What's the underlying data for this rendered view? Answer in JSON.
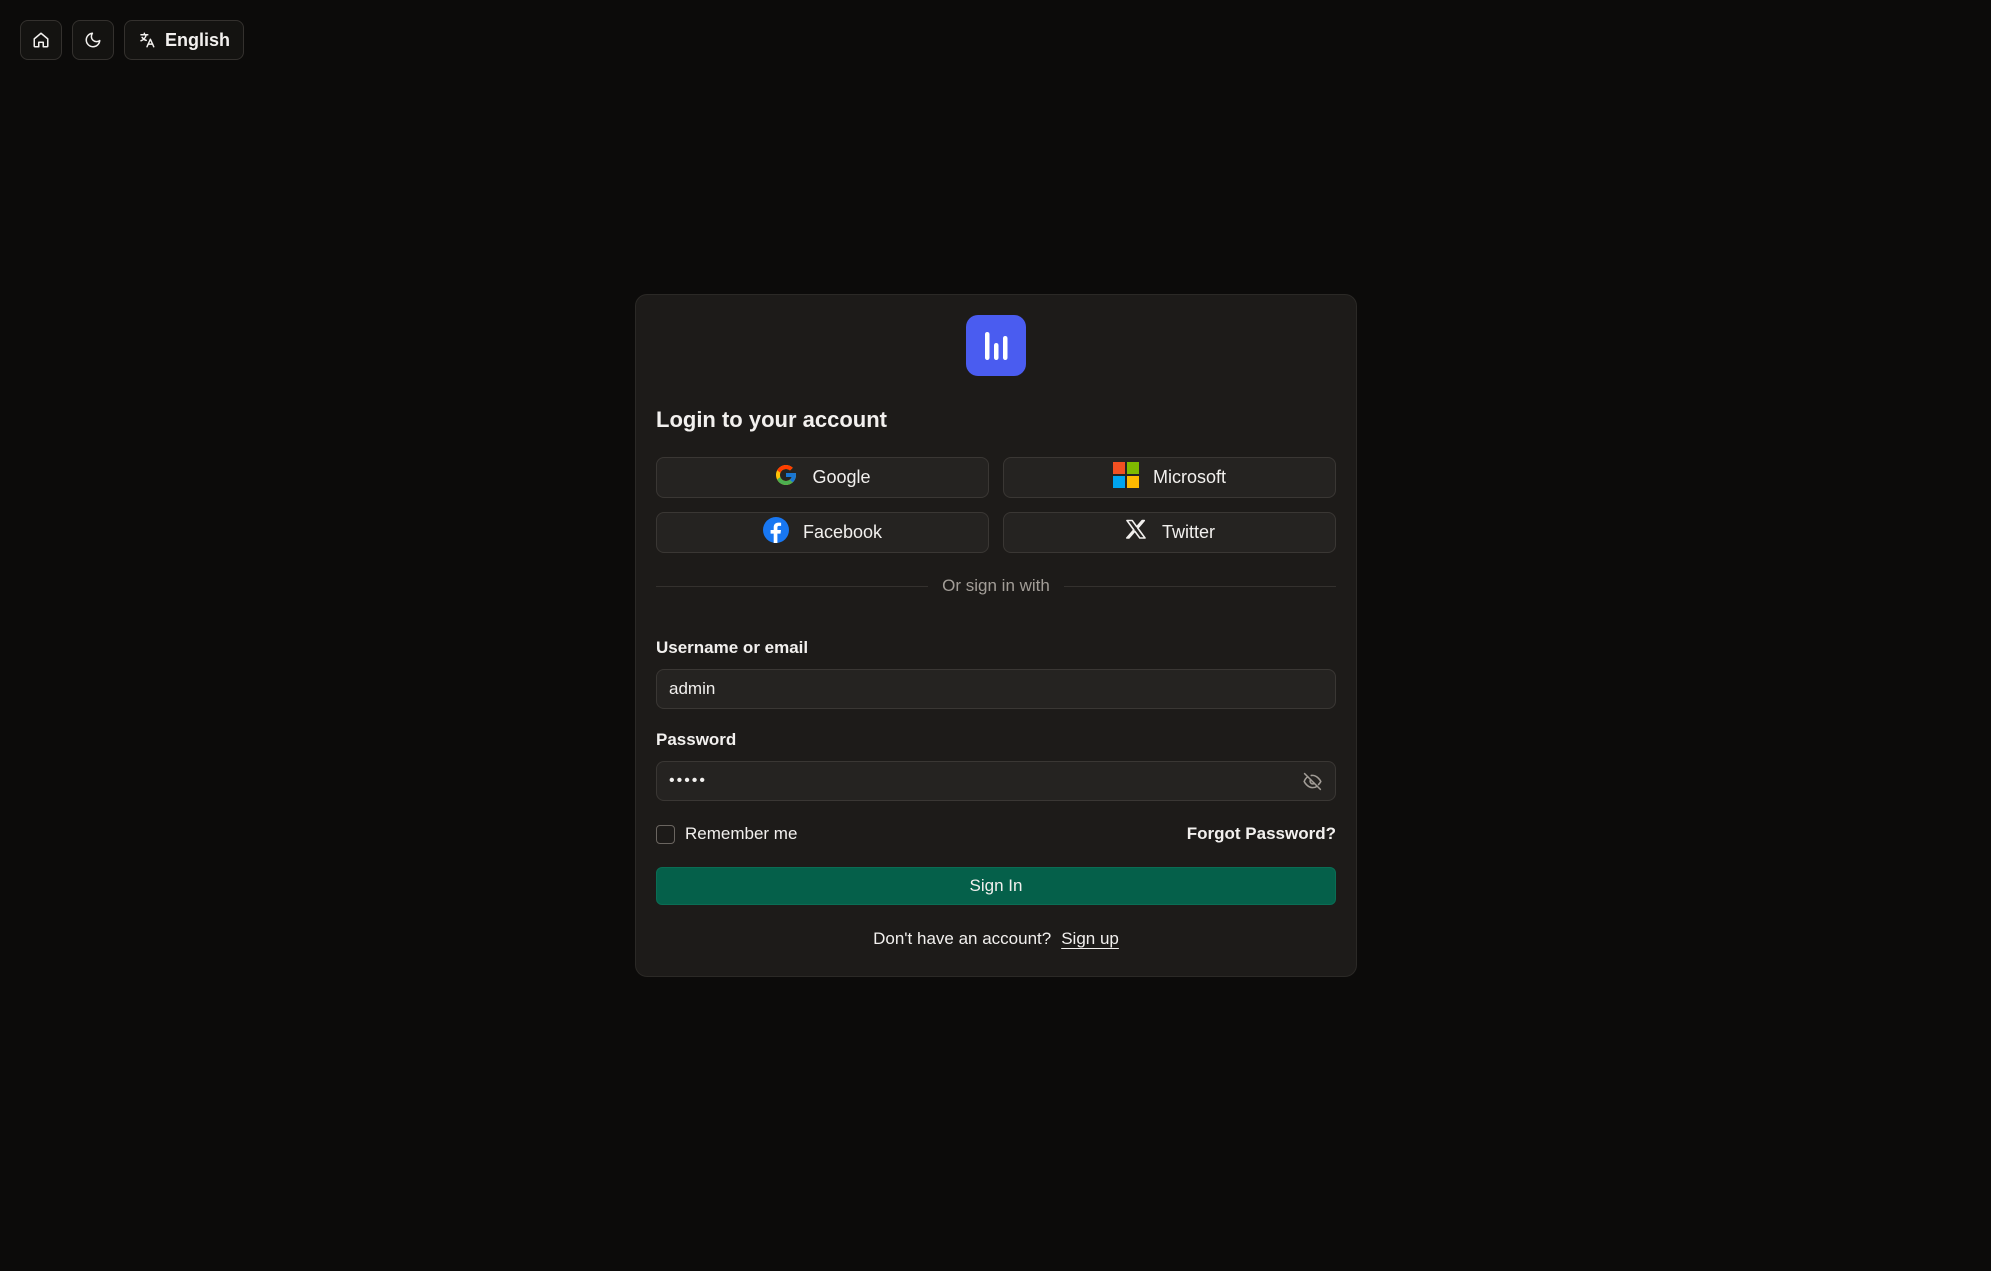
{
  "topbar": {
    "home_icon": "home-icon",
    "theme_icon": "moon-icon",
    "language_icon": "translate-icon",
    "language_label": "English"
  },
  "card": {
    "logo_icon": "bar-chart-logo",
    "logo_color": "#4a5cf0",
    "title": "Login to your account",
    "social": [
      {
        "label": "Google",
        "icon": "google-icon"
      },
      {
        "label": "Microsoft",
        "icon": "microsoft-icon"
      },
      {
        "label": "Facebook",
        "icon": "facebook-icon"
      },
      {
        "label": "Twitter",
        "icon": "x-twitter-icon"
      }
    ],
    "divider_text": "Or sign in with",
    "username": {
      "label": "Username or email",
      "value": "admin"
    },
    "password": {
      "label": "Password",
      "value": "admin",
      "visibility_icon": "eye-off-icon"
    },
    "remember_label": "Remember me",
    "remember_checked": false,
    "forgot_label": "Forgot Password?",
    "sign_in_label": "Sign In",
    "sign_in_color": "#05604a",
    "no_account_text": "Don't have an account?",
    "signup_label": "Sign up"
  }
}
